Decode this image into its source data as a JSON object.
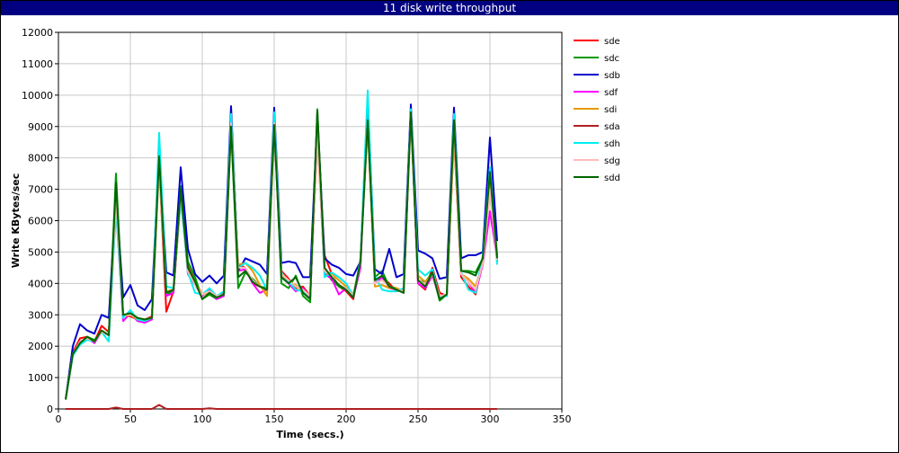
{
  "window": {
    "title": "11 disk write throughput"
  },
  "chart_data": {
    "type": "line",
    "title": "11 disk write throughput",
    "xlabel": "Time (secs.)",
    "ylabel": "Write KBytes/sec",
    "xlim": [
      0,
      350
    ],
    "ylim": [
      0,
      12000
    ],
    "xticks": [
      0,
      50,
      100,
      150,
      200,
      250,
      300,
      350
    ],
    "yticks": [
      0,
      1000,
      2000,
      3000,
      4000,
      5000,
      6000,
      7000,
      8000,
      9000,
      10000,
      11000,
      12000
    ],
    "grid": true,
    "legend_position": "right",
    "x": [
      5,
      10,
      15,
      20,
      25,
      30,
      35,
      40,
      45,
      50,
      55,
      60,
      65,
      70,
      75,
      80,
      85,
      90,
      95,
      100,
      105,
      110,
      115,
      120,
      125,
      130,
      135,
      140,
      145,
      150,
      155,
      160,
      165,
      170,
      175,
      180,
      185,
      190,
      195,
      200,
      205,
      210,
      215,
      220,
      225,
      230,
      235,
      240,
      245,
      250,
      255,
      260,
      265,
      270,
      275,
      280,
      285,
      290,
      295,
      300,
      305
    ],
    "series": [
      {
        "name": "sde",
        "color": "#ff0000",
        "values": [
          300,
          1800,
          2250,
          2300,
          2150,
          2650,
          2450,
          6700,
          3000,
          2950,
          2850,
          2850,
          2950,
          7850,
          3100,
          3750,
          6700,
          4550,
          4050,
          3650,
          3750,
          3600,
          3700,
          9300,
          4600,
          4500,
          4000,
          3900,
          3850,
          9000,
          4400,
          4150,
          3850,
          3900,
          3600,
          8700,
          4900,
          4300,
          3900,
          3750,
          3500,
          4800,
          9100,
          4000,
          4200,
          4000,
          3750,
          3800,
          9500,
          4000,
          3800,
          4500,
          3700,
          3600,
          8700,
          4200,
          3900,
          3650,
          4700,
          7500,
          4700
        ]
      },
      {
        "name": "sdc",
        "color": "#009900",
        "values": [
          300,
          1700,
          2050,
          2300,
          2200,
          2450,
          2350,
          7500,
          2950,
          3050,
          2900,
          2850,
          2900,
          8050,
          3600,
          3800,
          7100,
          4700,
          4200,
          3500,
          3650,
          3500,
          3600,
          9000,
          3850,
          4350,
          4150,
          3900,
          3850,
          9200,
          4000,
          3850,
          4250,
          3600,
          3400,
          9550,
          4450,
          4100,
          3900,
          3800,
          3550,
          4700,
          9300,
          4200,
          4400,
          3900,
          3850,
          3700,
          9550,
          4100,
          4050,
          4350,
          3450,
          3650,
          9300,
          4400,
          4400,
          4350,
          4800,
          7600,
          4900
        ]
      },
      {
        "name": "sdb",
        "color": "#0000cc",
        "values": [
          300,
          2000,
          2700,
          2500,
          2400,
          3000,
          2900,
          6800,
          3550,
          3950,
          3300,
          3150,
          3500,
          8200,
          4350,
          4250,
          7700,
          5100,
          4300,
          4050,
          4250,
          4000,
          4250,
          9650,
          4400,
          4800,
          4700,
          4600,
          4300,
          9600,
          4650,
          4700,
          4650,
          4200,
          4200,
          9300,
          4800,
          4600,
          4500,
          4300,
          4250,
          4700,
          9950,
          4450,
          4300,
          5100,
          4200,
          4300,
          9700,
          5050,
          4950,
          4800,
          4150,
          4200,
          9600,
          4800,
          4900,
          4900,
          5000,
          8650,
          5350
        ]
      },
      {
        "name": "sdf",
        "color": "#ff00ff",
        "values": [
          300,
          1750,
          2150,
          2250,
          2100,
          2450,
          2350,
          6400,
          2800,
          3050,
          2800,
          2750,
          2850,
          8600,
          3600,
          3700,
          6900,
          4300,
          3950,
          3600,
          3800,
          3500,
          3600,
          9300,
          4400,
          4450,
          4000,
          3700,
          3800,
          9300,
          4200,
          4000,
          3750,
          3850,
          3550,
          8900,
          4300,
          4150,
          3650,
          3850,
          3550,
          4500,
          9500,
          4000,
          4200,
          3850,
          3800,
          3750,
          9500,
          4000,
          3850,
          4250,
          3550,
          3650,
          9100,
          4300,
          4050,
          3700,
          4600,
          6300,
          4800
        ]
      },
      {
        "name": "sdi",
        "color": "#e69900",
        "values": [
          300,
          1750,
          2100,
          2250,
          2150,
          2500,
          2350,
          6650,
          2950,
          3000,
          2850,
          2850,
          2900,
          7700,
          3750,
          3800,
          6900,
          4400,
          4000,
          3650,
          3700,
          3600,
          3650,
          8950,
          4600,
          4650,
          4400,
          3950,
          3600,
          9050,
          4300,
          4050,
          3950,
          3700,
          3650,
          8700,
          4400,
          4300,
          4100,
          3900,
          3650,
          4750,
          9100,
          3900,
          3950,
          3850,
          3850,
          3750,
          9350,
          4250,
          4050,
          4300,
          3600,
          3650,
          8700,
          4300,
          4150,
          3900,
          4650,
          7350,
          4750
        ]
      },
      {
        "name": "sda",
        "color": "#b02020",
        "values": [
          0,
          0,
          0,
          0,
          0,
          0,
          0,
          50,
          0,
          0,
          0,
          0,
          0,
          130,
          0,
          0,
          0,
          0,
          0,
          0,
          20,
          0,
          0,
          0,
          0,
          0,
          0,
          0,
          0,
          0,
          0,
          0,
          0,
          0,
          0,
          0,
          0,
          0,
          0,
          0,
          0,
          0,
          0,
          0,
          0,
          0,
          0,
          0,
          0,
          0,
          0,
          0,
          0,
          0,
          0,
          0,
          0,
          0,
          0,
          0,
          0
        ]
      },
      {
        "name": "sdh",
        "color": "#00eeee",
        "values": [
          300,
          1700,
          2050,
          2200,
          2150,
          2450,
          2150,
          6400,
          2900,
          3150,
          2850,
          2800,
          2900,
          8800,
          3900,
          3850,
          6700,
          4350,
          3700,
          3650,
          3850,
          3600,
          3750,
          9400,
          4500,
          4650,
          4500,
          4250,
          3800,
          9450,
          4350,
          4050,
          3800,
          3750,
          3600,
          9200,
          4200,
          4350,
          4200,
          4000,
          3600,
          4750,
          10150,
          4250,
          3800,
          3750,
          3750,
          3850,
          9550,
          4450,
          4250,
          4450,
          3550,
          3600,
          9400,
          4350,
          3800,
          3700,
          4900,
          7700,
          4600
        ]
      },
      {
        "name": "sdg",
        "color": "#ffbbbb",
        "values": [
          300,
          1750,
          2150,
          2250,
          2150,
          2450,
          2350,
          6700,
          3000,
          3000,
          2900,
          2850,
          2900,
          7800,
          3700,
          3800,
          6900,
          4400,
          3950,
          3650,
          3750,
          3600,
          3650,
          9100,
          4500,
          4500,
          4100,
          3900,
          3800,
          9100,
          4300,
          4100,
          3900,
          3800,
          3600,
          8800,
          4400,
          4250,
          3950,
          3850,
          3600,
          4650,
          9200,
          4000,
          4100,
          3900,
          3800,
          3750,
          9400,
          4150,
          3950,
          4300,
          3600,
          3650,
          8900,
          4300,
          4050,
          3800,
          4650,
          7000,
          4750
        ]
      },
      {
        "name": "sdd",
        "color": "#006600",
        "values": [
          300,
          1750,
          2100,
          2300,
          2150,
          2500,
          2350,
          7200,
          3000,
          3050,
          2900,
          2850,
          2900,
          8050,
          3700,
          3800,
          7000,
          4500,
          4050,
          3500,
          3700,
          3550,
          3650,
          9000,
          4200,
          4400,
          4050,
          3900,
          3800,
          9050,
          4200,
          4000,
          4200,
          3700,
          3500,
          9500,
          4500,
          4200,
          3950,
          3800,
          3550,
          4700,
          9200,
          4100,
          4250,
          3900,
          3800,
          3700,
          9450,
          4100,
          3900,
          4350,
          3500,
          3650,
          9200,
          4400,
          4350,
          4250,
          4800,
          7550,
          4800
        ]
      }
    ]
  }
}
